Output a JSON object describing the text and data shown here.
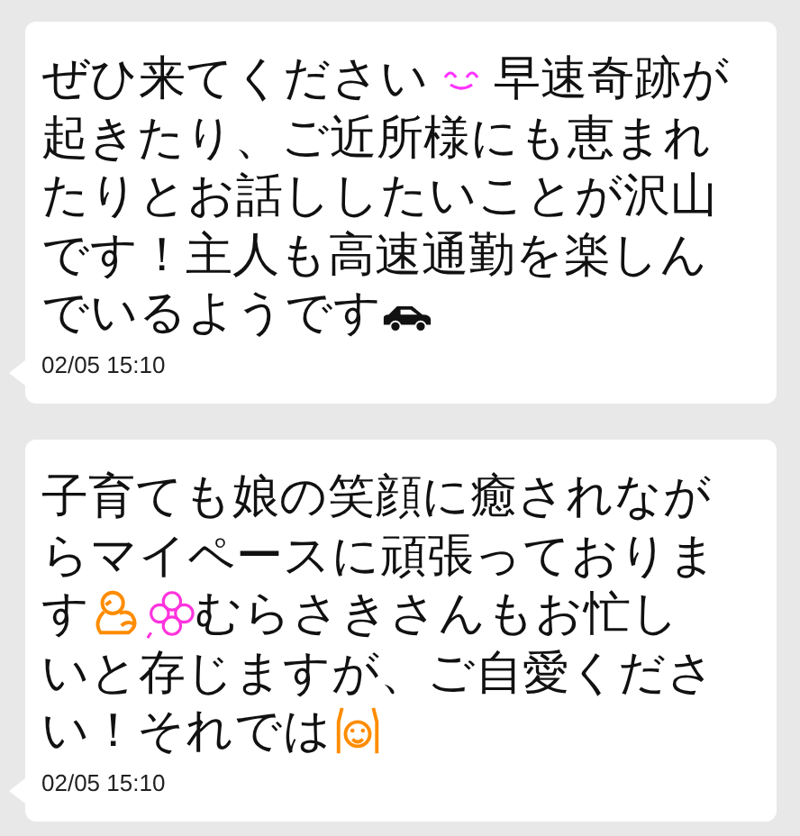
{
  "messages": [
    {
      "lines": [
        {
          "segments": [
            {
              "kind": "text",
              "text": "ぜひ来てください"
            },
            {
              "kind": "smile"
            },
            {
              "kind": "text",
              "text": "早速奇跡が"
            }
          ]
        },
        {
          "segments": [
            {
              "kind": "text",
              "text": "起きたり、ご近所様にも恵まれ"
            }
          ]
        },
        {
          "segments": [
            {
              "kind": "text",
              "text": "たりとお話ししたいことが沢山"
            }
          ]
        },
        {
          "segments": [
            {
              "kind": "text",
              "text": "です！主人も高速通勤を楽しん"
            }
          ]
        },
        {
          "segments": [
            {
              "kind": "text",
              "text": "でいるようです"
            },
            {
              "kind": "car"
            }
          ]
        }
      ],
      "time": "02/05 15:10"
    },
    {
      "lines": [
        {
          "segments": [
            {
              "kind": "text",
              "text": "子育ても娘の笑顔に癒されなが"
            }
          ]
        },
        {
          "segments": [
            {
              "kind": "text",
              "text": "らマイペースに頑張っておりま"
            }
          ]
        },
        {
          "segments": [
            {
              "kind": "text",
              "text": "す"
            },
            {
              "kind": "chick"
            },
            {
              "kind": "flower"
            },
            {
              "kind": "text",
              "text": "むらさきさんもお忙し"
            }
          ]
        },
        {
          "segments": [
            {
              "kind": "text",
              "text": "いと存じますが、ご自愛くださ"
            }
          ]
        },
        {
          "segments": [
            {
              "kind": "text",
              "text": "い！それでは"
            },
            {
              "kind": "cheer"
            }
          ]
        }
      ],
      "time": "02/05 15:10"
    }
  ]
}
